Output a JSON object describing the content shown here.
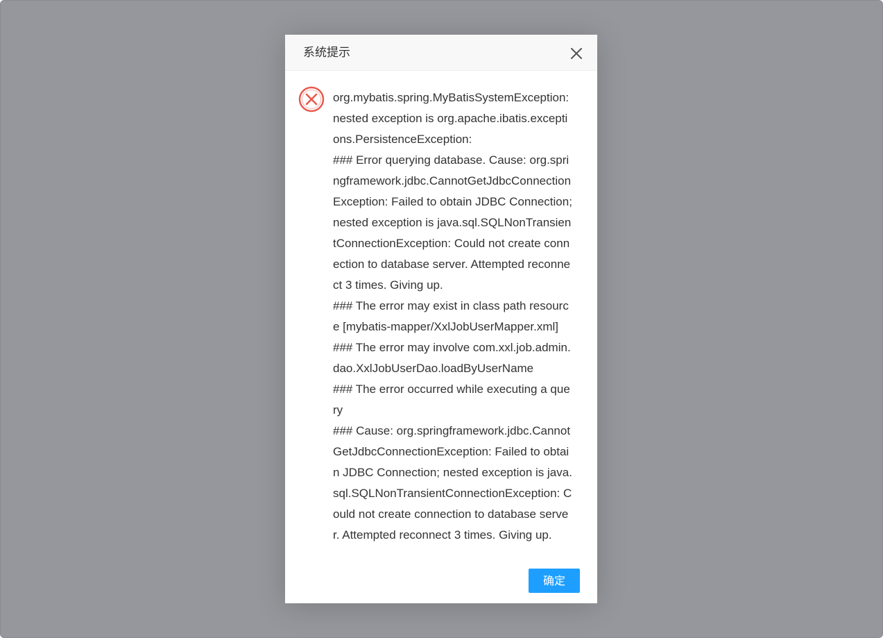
{
  "dialog": {
    "title": "系统提示",
    "close_icon": "close-icon",
    "status_icon": "error-circle-icon",
    "status_color": "#e85a4f",
    "accent_color": "#1e9fff",
    "message_lines": [
      "org.mybatis.spring.MyBatisSystemException:",
      "nested exception is org.apache.ibatis.excepti",
      "ons.PersistenceException:",
      "### Error querying database. Cause: org.spri",
      "ngframework.jdbc.CannotGetJdbcConnection",
      "Exception: Failed to obtain JDBC Connection;",
      "nested exception is java.sql.SQLNonTransien",
      "tConnectionException: Could not create conn",
      "ection to database server. Attempted reconne",
      "ct 3 times. Giving up.",
      "### The error may exist in class path resourc",
      "e [mybatis-mapper/XxlJobUserMapper.xml]",
      "### The error may involve com.xxl.job.admin.",
      "dao.XxlJobUserDao.loadByUserName",
      "### The error occurred while executing a que",
      "ry",
      "### Cause: org.springframework.jdbc.Cannot",
      "GetJdbcConnectionException: Failed to obtai",
      "n JDBC Connection; nested exception is java.",
      "sql.SQLNonTransientConnectionException: C",
      "ould not create connection to database serve",
      "r. Attempted reconnect 3 times. Giving up."
    ],
    "ok_label": "确定"
  }
}
